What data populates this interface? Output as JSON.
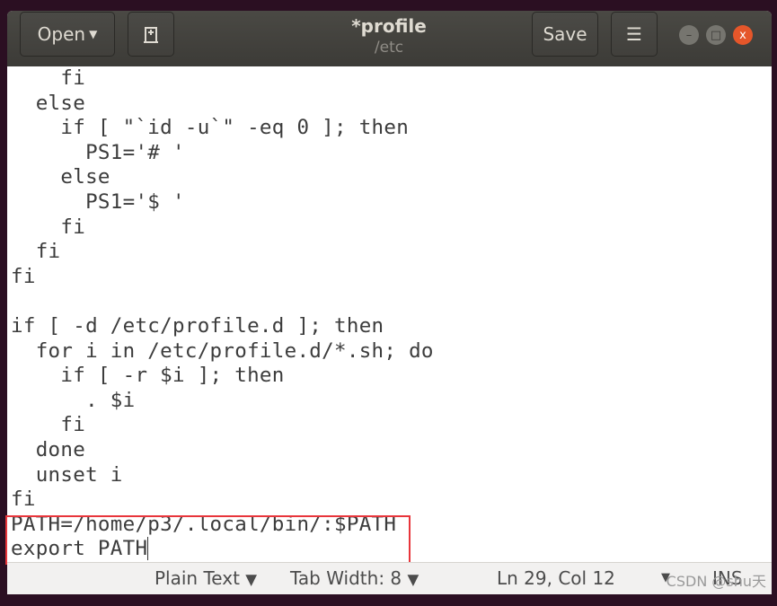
{
  "window": {
    "title": "*profile",
    "subtitle": "/etc"
  },
  "toolbar": {
    "open_label": "Open",
    "save_label": "Save",
    "new_tab_icon": "new-document-icon",
    "menu_icon": "hamburger-icon"
  },
  "editor": {
    "lines": [
      "    fi",
      "  else",
      "    if [ \"`id -u`\" -eq 0 ]; then",
      "      PS1='# '",
      "    else",
      "      PS1='$ '",
      "    fi",
      "  fi",
      "fi",
      "",
      "if [ -d /etc/profile.d ]; then",
      "  for i in /etc/profile.d/*.sh; do",
      "    if [ -r $i ]; then",
      "      . $i",
      "    fi",
      "  done",
      "  unset i",
      "fi",
      "PATH=/home/p3/.local/bin/:$PATH",
      "export PATH"
    ],
    "highlight_color": "#e8353b"
  },
  "status": {
    "language": "Plain Text",
    "tab_width": "Tab Width: 8",
    "position": "Ln 29, Col 12",
    "mode": "INS"
  },
  "watermark": "CSDN @shu天"
}
